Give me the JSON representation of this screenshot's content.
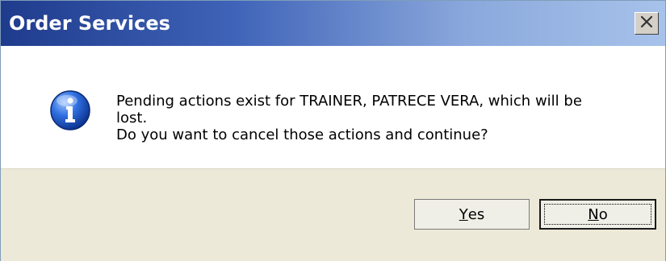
{
  "dialog": {
    "title": "Order Services",
    "close_icon": "close-icon",
    "info_icon": "information-icon",
    "message_lines": [
      "Pending actions exist for TRAINER, PATRECE VERA, which will be",
      "lost.",
      "Do you want to cancel those actions and continue?"
    ],
    "buttons": {
      "yes": {
        "mnemonic": "Y",
        "rest": "es"
      },
      "no": {
        "mnemonic": "N",
        "rest": "o"
      }
    }
  },
  "colors": {
    "titlebar_start": "#1f3b8c",
    "titlebar_end": "#a7c2ea",
    "button_bar": "#ece9d8",
    "info_icon_blue": "#1a55c8"
  }
}
